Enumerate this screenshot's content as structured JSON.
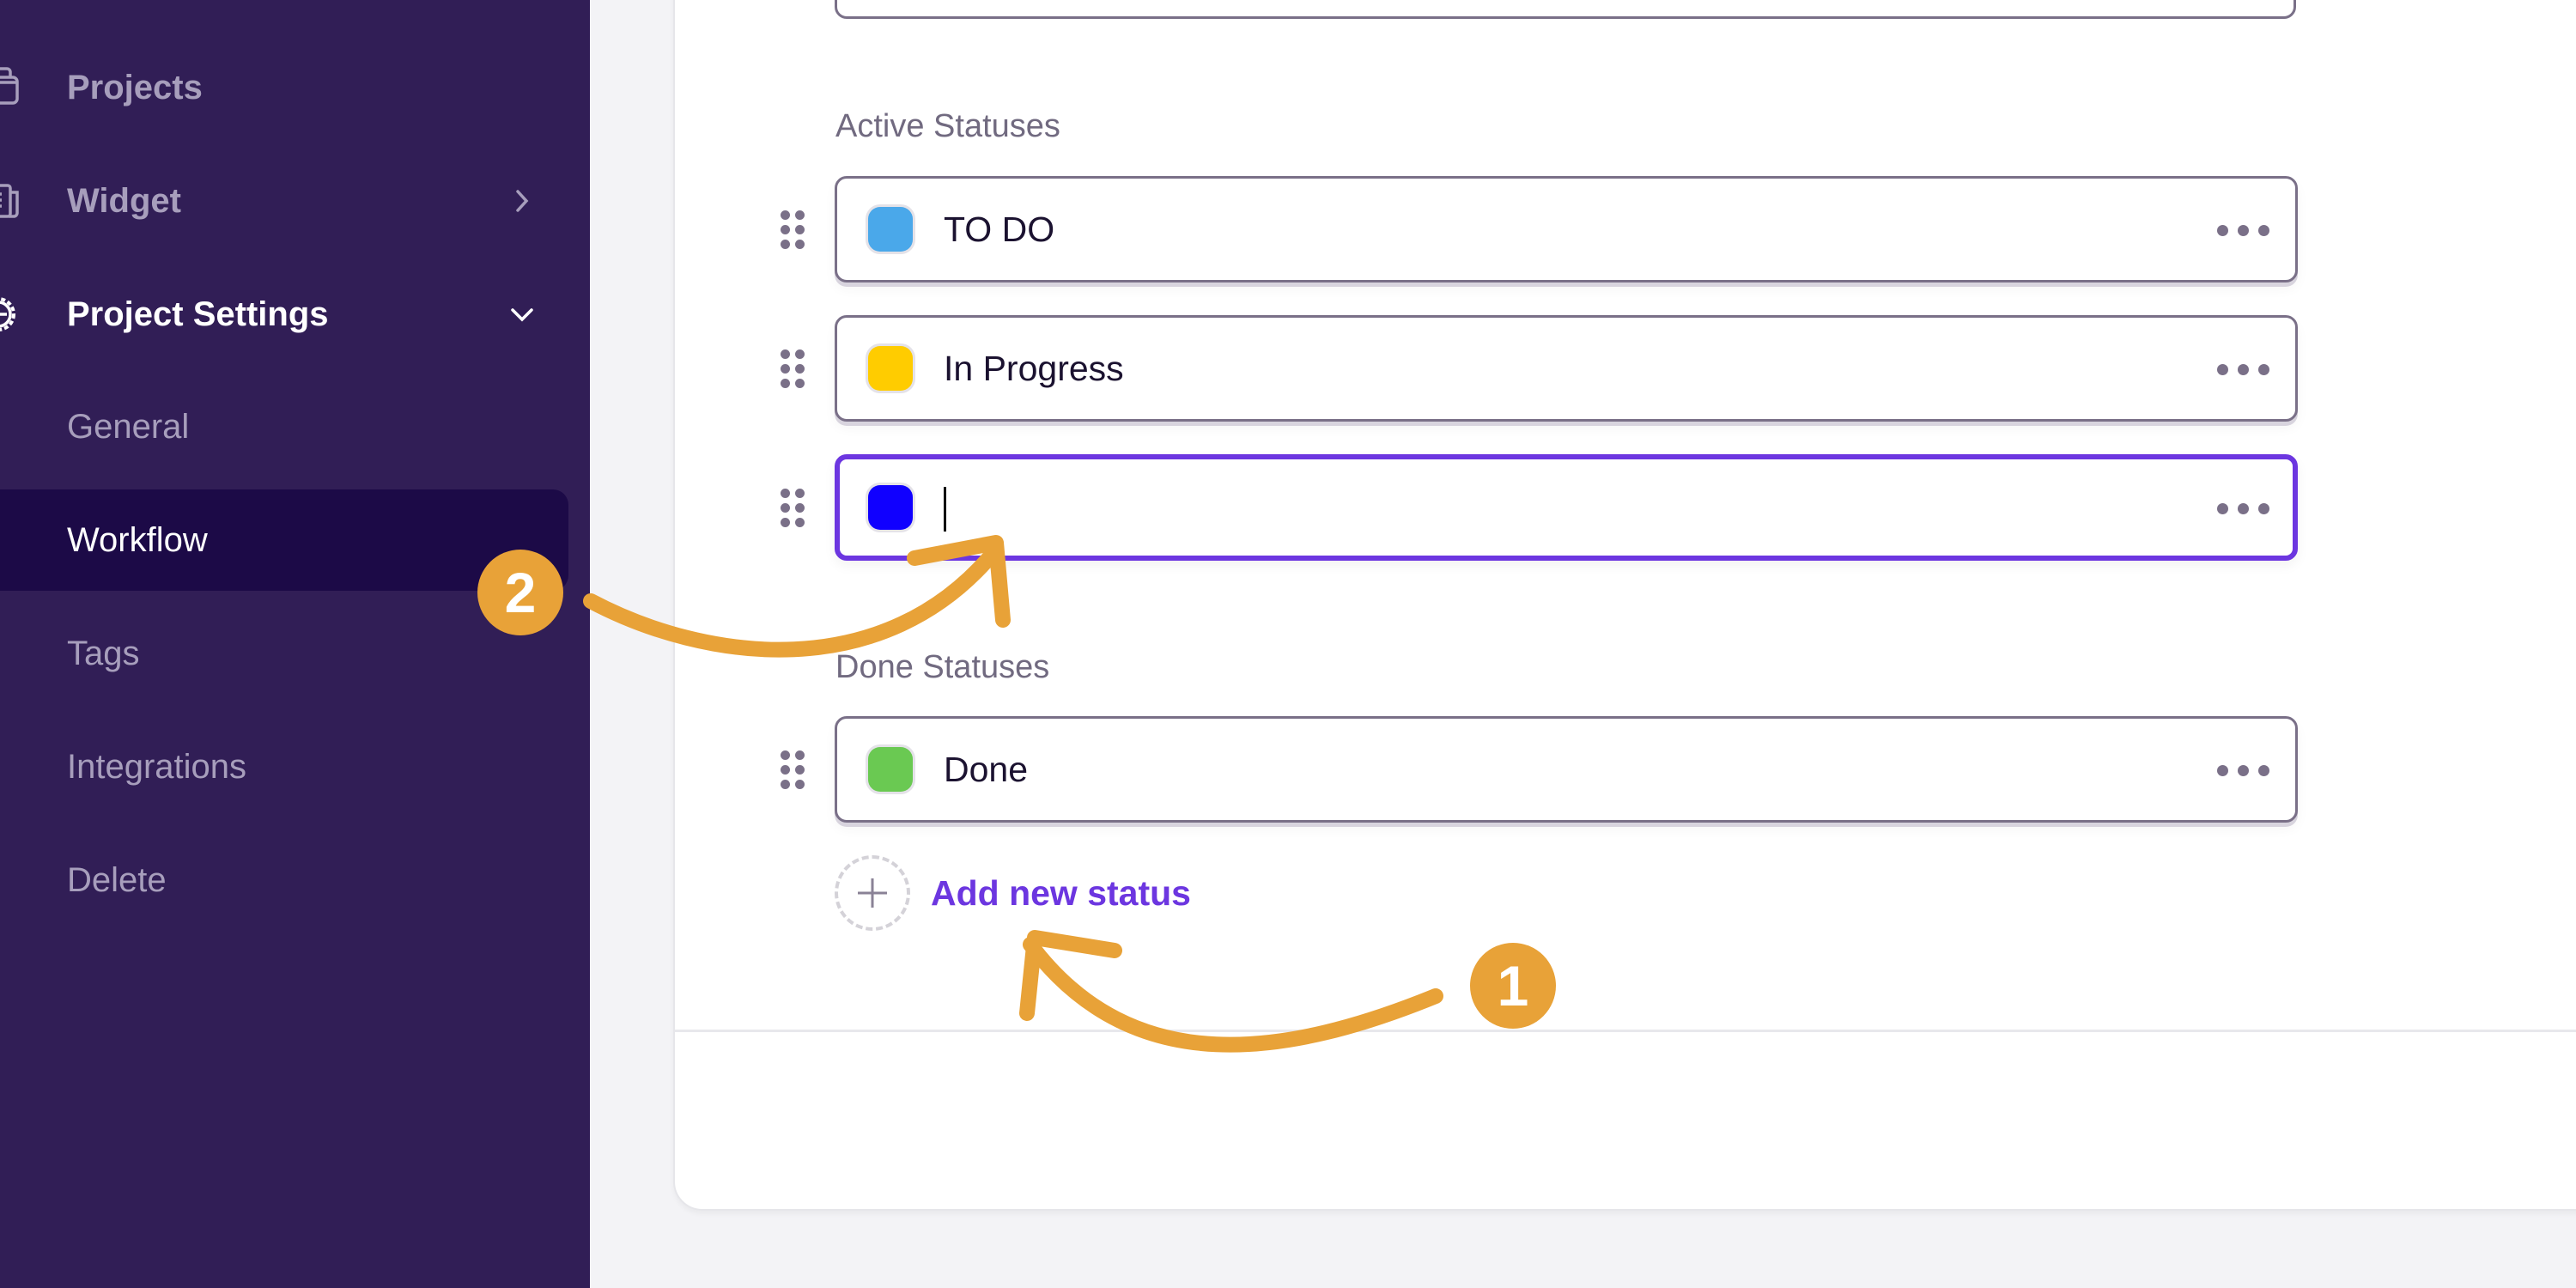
{
  "sidebar": {
    "items": [
      {
        "label": "Projects",
        "icon": "folder-stack-icon"
      },
      {
        "label": "Widget",
        "icon": "document-widget-icon",
        "chevron": "chevron-right-icon"
      },
      {
        "label": "Project Settings",
        "icon": "gear-icon",
        "chevron": "chevron-down-icon",
        "expanded": true
      }
    ],
    "sub_items": [
      {
        "label": "General"
      },
      {
        "label": "Workflow",
        "active": true
      },
      {
        "label": "Tags"
      },
      {
        "label": "Integrations"
      },
      {
        "label": "Delete"
      }
    ]
  },
  "workflow": {
    "active_section_label": "Active Statuses",
    "active_statuses": [
      {
        "name": "TO DO",
        "color": "#4aa8ea"
      },
      {
        "name": "In Progress",
        "color": "#ffcc00"
      },
      {
        "name": "",
        "color": "#1000ff",
        "editing": true
      }
    ],
    "done_section_label": "Done Statuses",
    "done_statuses": [
      {
        "name": "Done",
        "color": "#6ac952"
      }
    ],
    "add_status_label": "Add new status"
  },
  "annotations": {
    "step1": "1",
    "step2": "2",
    "color": "#e8a238"
  },
  "colors": {
    "sidebar_bg": "#311e56",
    "sidebar_active_bg": "#1c0a47",
    "accent": "#6c36e0"
  }
}
